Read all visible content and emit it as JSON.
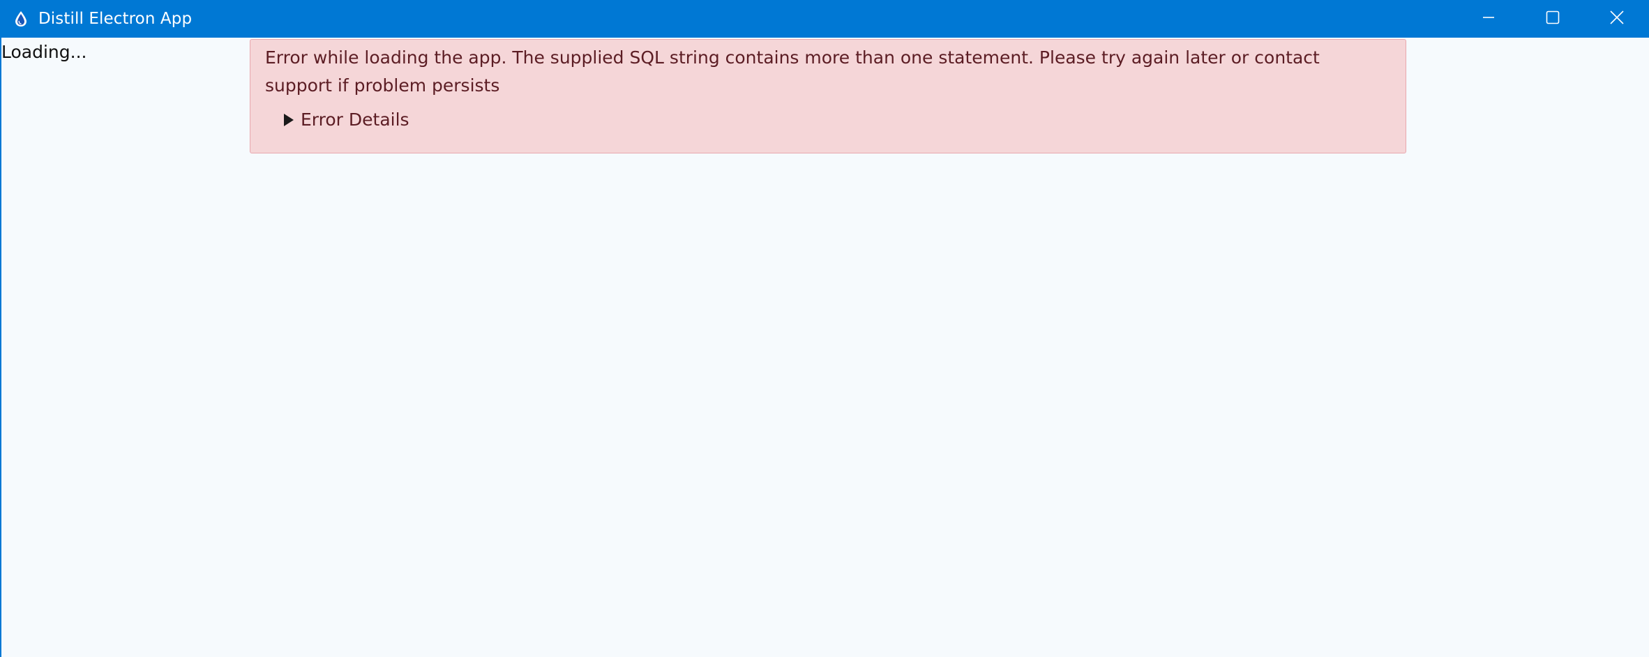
{
  "window": {
    "title": "Distill Electron App",
    "app_icon": "water-drop-icon",
    "controls": {
      "minimize_icon": "minimize-icon",
      "maximize_icon": "maximize-icon",
      "close_icon": "close-icon"
    },
    "accent_color": "#0078d4"
  },
  "content": {
    "loading_text": "Loading...",
    "alert": {
      "message": "Error while loading the app. The supplied SQL string contains more than one statement. Please try again later or contact support if problem persists",
      "details_label": "Error Details",
      "details_icon": "disclosure-triangle-icon",
      "background_color": "#f5d6d8",
      "border_color": "#e8a7ae",
      "text_color": "#5c1d24"
    }
  }
}
